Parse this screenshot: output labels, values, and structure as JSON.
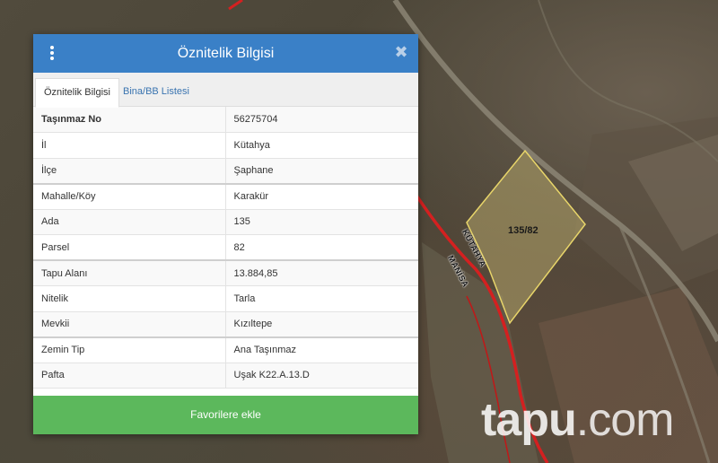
{
  "panel": {
    "title": "Öznitelik Bilgisi",
    "tabs": [
      {
        "label": "Öznitelik Bilgisi",
        "active": true
      },
      {
        "label": "Bina/BB Listesi",
        "active": false
      }
    ],
    "rows": [
      {
        "key": "Taşınmaz No",
        "value": "56275704"
      },
      {
        "key": "İl",
        "value": "Kütahya"
      },
      {
        "key": "İlçe",
        "value": "Şaphane"
      },
      {
        "key": "Mahalle/Köy",
        "value": "Karakür"
      },
      {
        "key": "Ada",
        "value": "135"
      },
      {
        "key": "Parsel",
        "value": "82"
      },
      {
        "key": "Tapu Alanı",
        "value": "13.884,85"
      },
      {
        "key": "Nitelik",
        "value": "Tarla"
      },
      {
        "key": "Mevkii",
        "value": "Kızıltepe"
      },
      {
        "key": "Zemin Tip",
        "value": "Ana Taşınmaz"
      },
      {
        "key": "Pafta",
        "value": "Uşak K22.A.13.D"
      }
    ],
    "favorite_label": "Favorilere ekle",
    "header_color": "#3a80c7",
    "button_color": "#5cb85c"
  },
  "map": {
    "parcel_label": "135/82",
    "road_labels": [
      "MANİSA",
      "KÜTAHYA"
    ],
    "watermark_main": "tapu",
    "watermark_suffix": ".com"
  },
  "icons": {
    "menu": "vertical-dots-icon",
    "close": "close-icon"
  }
}
